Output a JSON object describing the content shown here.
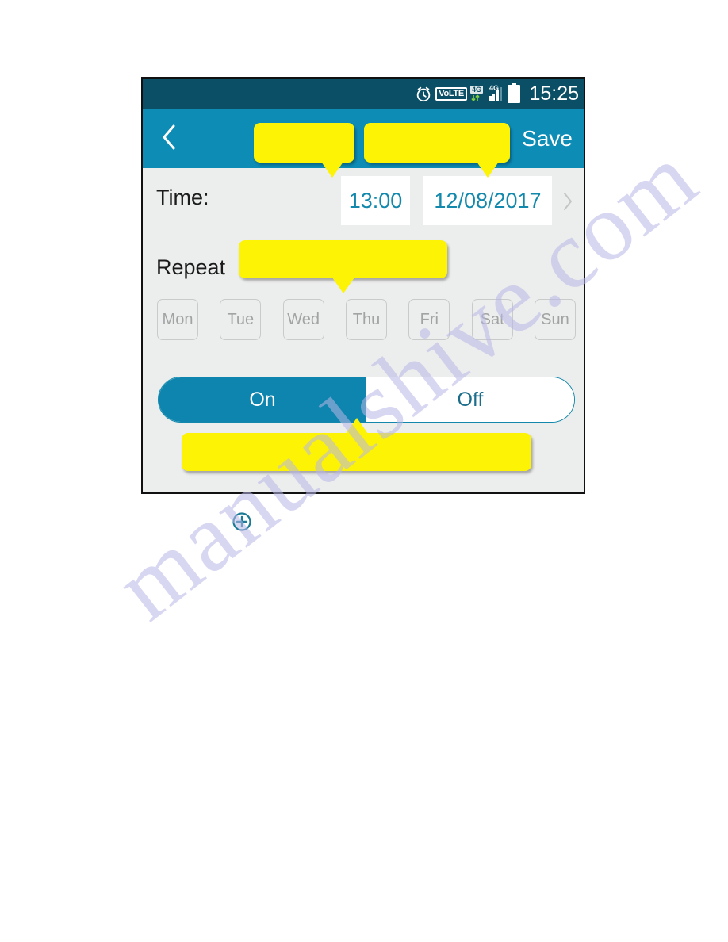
{
  "page": {
    "watermark": "manualshive.com"
  },
  "phone": {
    "status_bar": {
      "icons": [
        "alarm-clock-icon",
        "volte-icon",
        "data-4g-icon",
        "signal-4g-icon",
        "battery-icon"
      ],
      "volte_label": "VoLTE",
      "data_label": "4G",
      "signal_label": "4G",
      "clock": "15:25"
    },
    "app_bar": {
      "back_icon": "back-chevron-icon",
      "title": ":",
      "save_label": "Save"
    },
    "form": {
      "time_label": "Time:",
      "time_value": "13:00",
      "date_value": "12/08/2017",
      "row_chevron_icon": "chevron-right-icon",
      "repeat_label": "Repeat",
      "days": [
        {
          "label": "Mon",
          "selected": false
        },
        {
          "label": "Tue",
          "selected": false
        },
        {
          "label": "Wed",
          "selected": false
        },
        {
          "label": "Thu",
          "selected": false
        },
        {
          "label": "Fri",
          "selected": false
        },
        {
          "label": "Sat",
          "selected": false
        },
        {
          "label": "Sun",
          "selected": false
        }
      ],
      "toggle": {
        "on_label": "On",
        "off_label": "Off",
        "selected": "On"
      }
    }
  },
  "annotations": {
    "callout_title_1": "",
    "callout_title_2": "",
    "callout_repeat": "",
    "callout_bottom": ""
  },
  "footer": {
    "plus_icon": "circled-plus-icon"
  },
  "colors": {
    "status_bar": "#0a4f66",
    "app_bar": "#0d8cb6",
    "accent": "#1289ac",
    "toggle_on": "#0d85ae",
    "screen_bg": "#eceded",
    "callout": "#fcf305",
    "day_text": "#a2a4a4",
    "watermark": "#b9b7e8"
  }
}
